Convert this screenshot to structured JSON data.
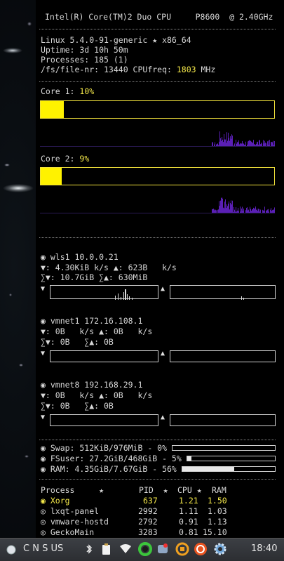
{
  "cpu_header": "Intel(R) Core(TM)2 Duo CPU     P8600  @ 2.40GHz",
  "system": {
    "kernel": "Linux 5.4.0-91-generic ★ x86_64",
    "uptime": "Uptime: 3d 10h 50m",
    "processes": "Processes: 185 (1)",
    "filenr_prefix": "/fs/file-nr: 13440 CPUfreq: ",
    "cpufreq": "1803",
    "cpufreq_unit": " MHz"
  },
  "cores": [
    {
      "label": "Core 1: ",
      "value": "10%",
      "fill": 0.1
    },
    {
      "label": "Core 2: ",
      "value": "9%",
      "fill": 0.09
    }
  ],
  "network": [
    {
      "iface": "◉ wls1 10.0.0.21",
      "rate": "▼: 4.30KiB k/s ▲: 623B   k/s",
      "total": "∑▼: 10.7GiB ∑▲: 630MiB"
    },
    {
      "iface": "◉ vmnet1 172.16.108.1",
      "rate": "▼: 0B   k/s ▲: 0B   k/s",
      "total": "∑▼: 0B   ∑▲: 0B"
    },
    {
      "iface": "◉ vmnet8 192.168.29.1",
      "rate": "▼: 0B   k/s ▲: 0B   k/s",
      "total": "∑▼: 0B   ∑▲: 0B"
    }
  ],
  "arrows": {
    "down": "▼",
    "up": "▲"
  },
  "resources": [
    {
      "text": "◉ Swap: 512KiB/976MiB - 0%",
      "fill": 0.0
    },
    {
      "text": "◉ FSuser: 27.2GiB/468GiB - 5%",
      "fill": 0.05
    },
    {
      "text": "◉ RAM: 4.35GiB/7.67GiB - 56%",
      "fill": 0.56
    }
  ],
  "process_table": {
    "headers": {
      "process": "Process     ★",
      "pid": "PID  ★",
      "cpu": "CPU ★",
      "ram": "RAM"
    },
    "rows": [
      {
        "name": "◉ Xorg",
        "pid": "637",
        "cpu": "1.21",
        "ram": "1.50",
        "highlight": true
      },
      {
        "name": "◎ lxqt-panel",
        "pid": "2992",
        "cpu": "1.11",
        "ram": "1.03",
        "highlight": false
      },
      {
        "name": "◎ vmware-hostd",
        "pid": "2792",
        "cpu": "0.91",
        "ram": "1.13",
        "highlight": false
      },
      {
        "name": "◎ GeckoMain",
        "pid": "3283",
        "cpu": "0.81",
        "ram": "15.10",
        "highlight": false
      }
    ]
  },
  "taskbar": {
    "keyboard_indicator": "C N S US",
    "clock": "18:40",
    "tray_icons": [
      "bluetooth-icon",
      "clipboard-icon",
      "wifi-icon",
      "green-ring-icon",
      "messenger-icon",
      "sync-icon",
      "update-icon",
      "settings-gear-icon"
    ]
  },
  "colors": {
    "accent": "#fff200",
    "graph": "#5a1fb5",
    "text": "#d8d8d8",
    "highlight": "#f5e94a"
  }
}
